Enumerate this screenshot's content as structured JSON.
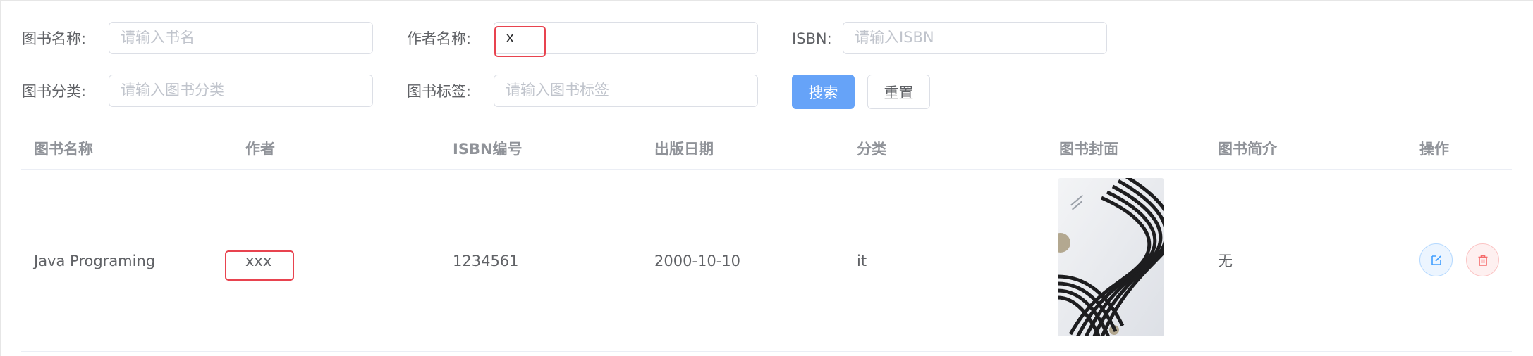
{
  "search": {
    "book_name_label": "图书名称:",
    "book_name_placeholder": "请输入书名",
    "author_label": "作者名称:",
    "author_value": "x",
    "isbn_label": "ISBN:",
    "isbn_placeholder": "请输入ISBN",
    "category_label": "图书分类:",
    "category_placeholder": "请输入图书分类",
    "tag_label": "图书标签:",
    "tag_placeholder": "请输入图书标签",
    "search_button": "搜索",
    "reset_button": "重置"
  },
  "table": {
    "headers": [
      "图书名称",
      "作者",
      "ISBN编号",
      "出版日期",
      "分类",
      "图书封面",
      "图书简介",
      "操作"
    ],
    "rows": [
      {
        "name": "Java Programing",
        "author": "xxx",
        "isbn": "1234561",
        "date": "2000-10-10",
        "category": "it",
        "intro": "无"
      }
    ]
  },
  "icons": {
    "edit": "edit-icon",
    "delete": "trash-icon"
  },
  "colors": {
    "primary": "#66a3f8",
    "highlight": "#e8434f",
    "edit_bg": "#ecf5ff",
    "delete_bg": "#fef0f0"
  }
}
